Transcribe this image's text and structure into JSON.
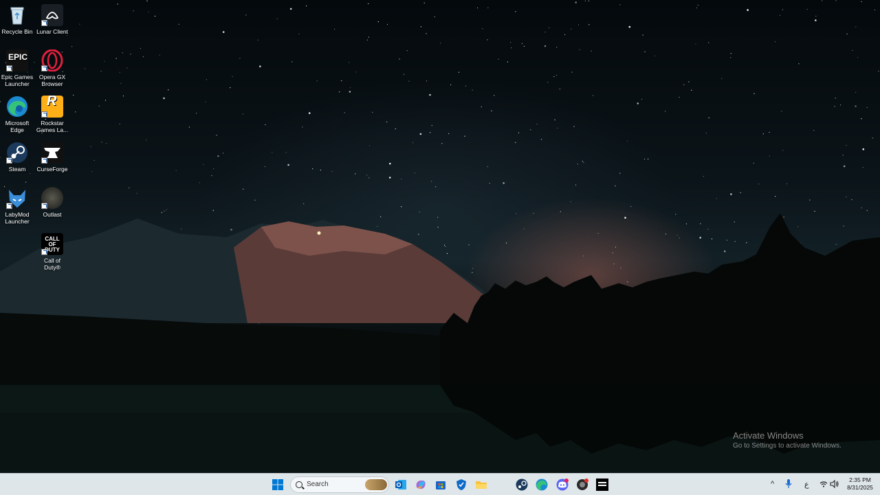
{
  "desktop": {
    "icons": [
      {
        "label": "Recycle Bin",
        "icon": "recycle-bin-icon"
      },
      {
        "label": "Lunar Client",
        "icon": "lunar-client-icon"
      },
      {
        "label": "Epic Games Launcher",
        "icon": "epic-games-icon",
        "glyph_text": "EPIC"
      },
      {
        "label": "Opera GX Browser",
        "icon": "opera-gx-icon"
      },
      {
        "label": "Microsoft Edge",
        "icon": "edge-icon"
      },
      {
        "label": "Rockstar Games La...",
        "icon": "rockstar-icon",
        "glyph_text": "R"
      },
      {
        "label": "Steam",
        "icon": "steam-icon"
      },
      {
        "label": "CurseForge",
        "icon": "curseforge-icon"
      },
      {
        "label": "LabyMod Launcher",
        "icon": "labymod-icon"
      },
      {
        "label": "Outlast",
        "icon": "outlast-icon"
      },
      {
        "label": "Call of Duty®",
        "icon": "call-of-duty-icon",
        "glyph_text": "CALL OF DUTY"
      }
    ],
    "watermark": {
      "title": "Activate Windows",
      "subtitle": "Go to Settings to activate Windows."
    }
  },
  "taskbar": {
    "search_placeholder": "Search",
    "apps": [
      "start-icon",
      "outlook-icon",
      "copilot-icon",
      "microsoft-store-icon",
      "security-icon",
      "file-explorer-icon",
      "steam-icon",
      "edge-icon",
      "discord-icon",
      "app-icon",
      "call-of-duty-icon"
    ],
    "tray": {
      "chevron": "^",
      "language": "ع",
      "time": "2:35 PM",
      "date": "8/31/2025"
    }
  },
  "colors": {
    "taskbar_bg": "#dfe6ea",
    "accent": "#0078d4"
  }
}
